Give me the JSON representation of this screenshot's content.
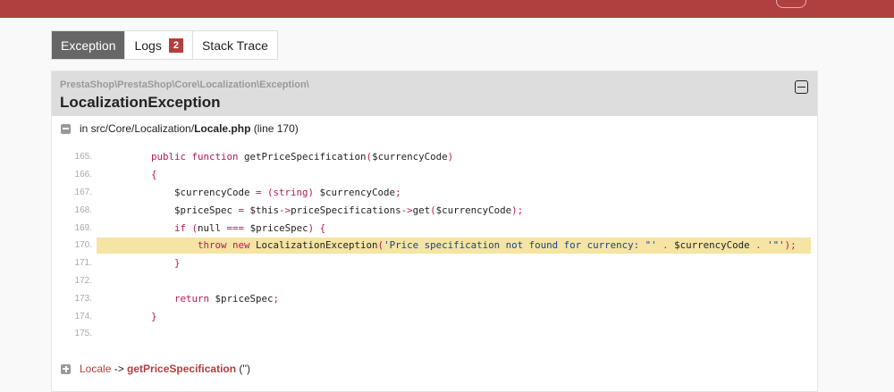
{
  "tabs": {
    "exception": "Exception",
    "logs": "Logs",
    "logs_count": "2",
    "stack_trace": "Stack Trace"
  },
  "exception": {
    "namespace": "PrestaShop\\PrestaShop\\Core\\Localization\\Exception\\",
    "class": "LocalizationException",
    "location_prefix": "in src/Core/Localization/",
    "file": "Locale.php",
    "line_info": "(line 170)"
  },
  "code": [
    {
      "n": "165.",
      "t": [
        [
          "",
          "    "
        ],
        [
          "k",
          "public function "
        ],
        [
          "t",
          "getPriceSpecification"
        ],
        [
          "k",
          "("
        ],
        [
          "t",
          "$currencyCode"
        ],
        [
          "k",
          ")"
        ]
      ]
    },
    {
      "n": "166.",
      "t": [
        [
          "",
          "    "
        ],
        [
          "k",
          "{"
        ]
      ]
    },
    {
      "n": "167.",
      "t": [
        [
          "",
          "        "
        ],
        [
          "t",
          "$currencyCode "
        ],
        [
          "k",
          "= (string) "
        ],
        [
          "t",
          "$currencyCode"
        ],
        [
          "k",
          ";"
        ]
      ]
    },
    {
      "n": "168.",
      "t": [
        [
          "",
          "        "
        ],
        [
          "t",
          "$priceSpec "
        ],
        [
          "k",
          "= "
        ],
        [
          "t",
          "$this"
        ],
        [
          "k",
          "->"
        ],
        [
          "t",
          "priceSpecifications"
        ],
        [
          "k",
          "->"
        ],
        [
          "t",
          "get"
        ],
        [
          "k",
          "("
        ],
        [
          "t",
          "$currencyCode"
        ],
        [
          "k",
          ");"
        ]
      ]
    },
    {
      "n": "169.",
      "t": [
        [
          "",
          "        "
        ],
        [
          "k",
          "if ("
        ],
        [
          "t",
          "null "
        ],
        [
          "k",
          "=== "
        ],
        [
          "t",
          "$priceSpec"
        ],
        [
          "k",
          ") {"
        ]
      ]
    },
    {
      "n": "170.",
      "hl": true,
      "t": [
        [
          "",
          "            "
        ],
        [
          "k",
          "throw new "
        ],
        [
          "t",
          "LocalizationException"
        ],
        [
          "k",
          "("
        ],
        [
          "s",
          "'Price specification not found for currency: \"' "
        ],
        [
          "k",
          ". "
        ],
        [
          "t",
          "$currencyCode "
        ],
        [
          "k",
          ". "
        ],
        [
          "s",
          "'\"'"
        ],
        [
          "k",
          ");"
        ]
      ]
    },
    {
      "n": "171.",
      "t": [
        [
          "",
          "        "
        ],
        [
          "k",
          "}"
        ]
      ]
    },
    {
      "n": "172.",
      "t": []
    },
    {
      "n": "173.",
      "t": [
        [
          "",
          "        "
        ],
        [
          "k",
          "return "
        ],
        [
          "t",
          "$priceSpec"
        ],
        [
          "k",
          ";"
        ]
      ]
    },
    {
      "n": "174.",
      "t": [
        [
          "",
          "    "
        ],
        [
          "k",
          "}"
        ]
      ]
    },
    {
      "n": "175.",
      "t": []
    }
  ],
  "trace": {
    "class": "Locale",
    "arrow": " -> ",
    "method": "getPriceSpecification",
    "args": " ('')"
  },
  "colors": {
    "brand": "#b0403f",
    "keyword": "#b5195a",
    "string": "#1d3f8f",
    "highlight": "#f5e4a3"
  }
}
